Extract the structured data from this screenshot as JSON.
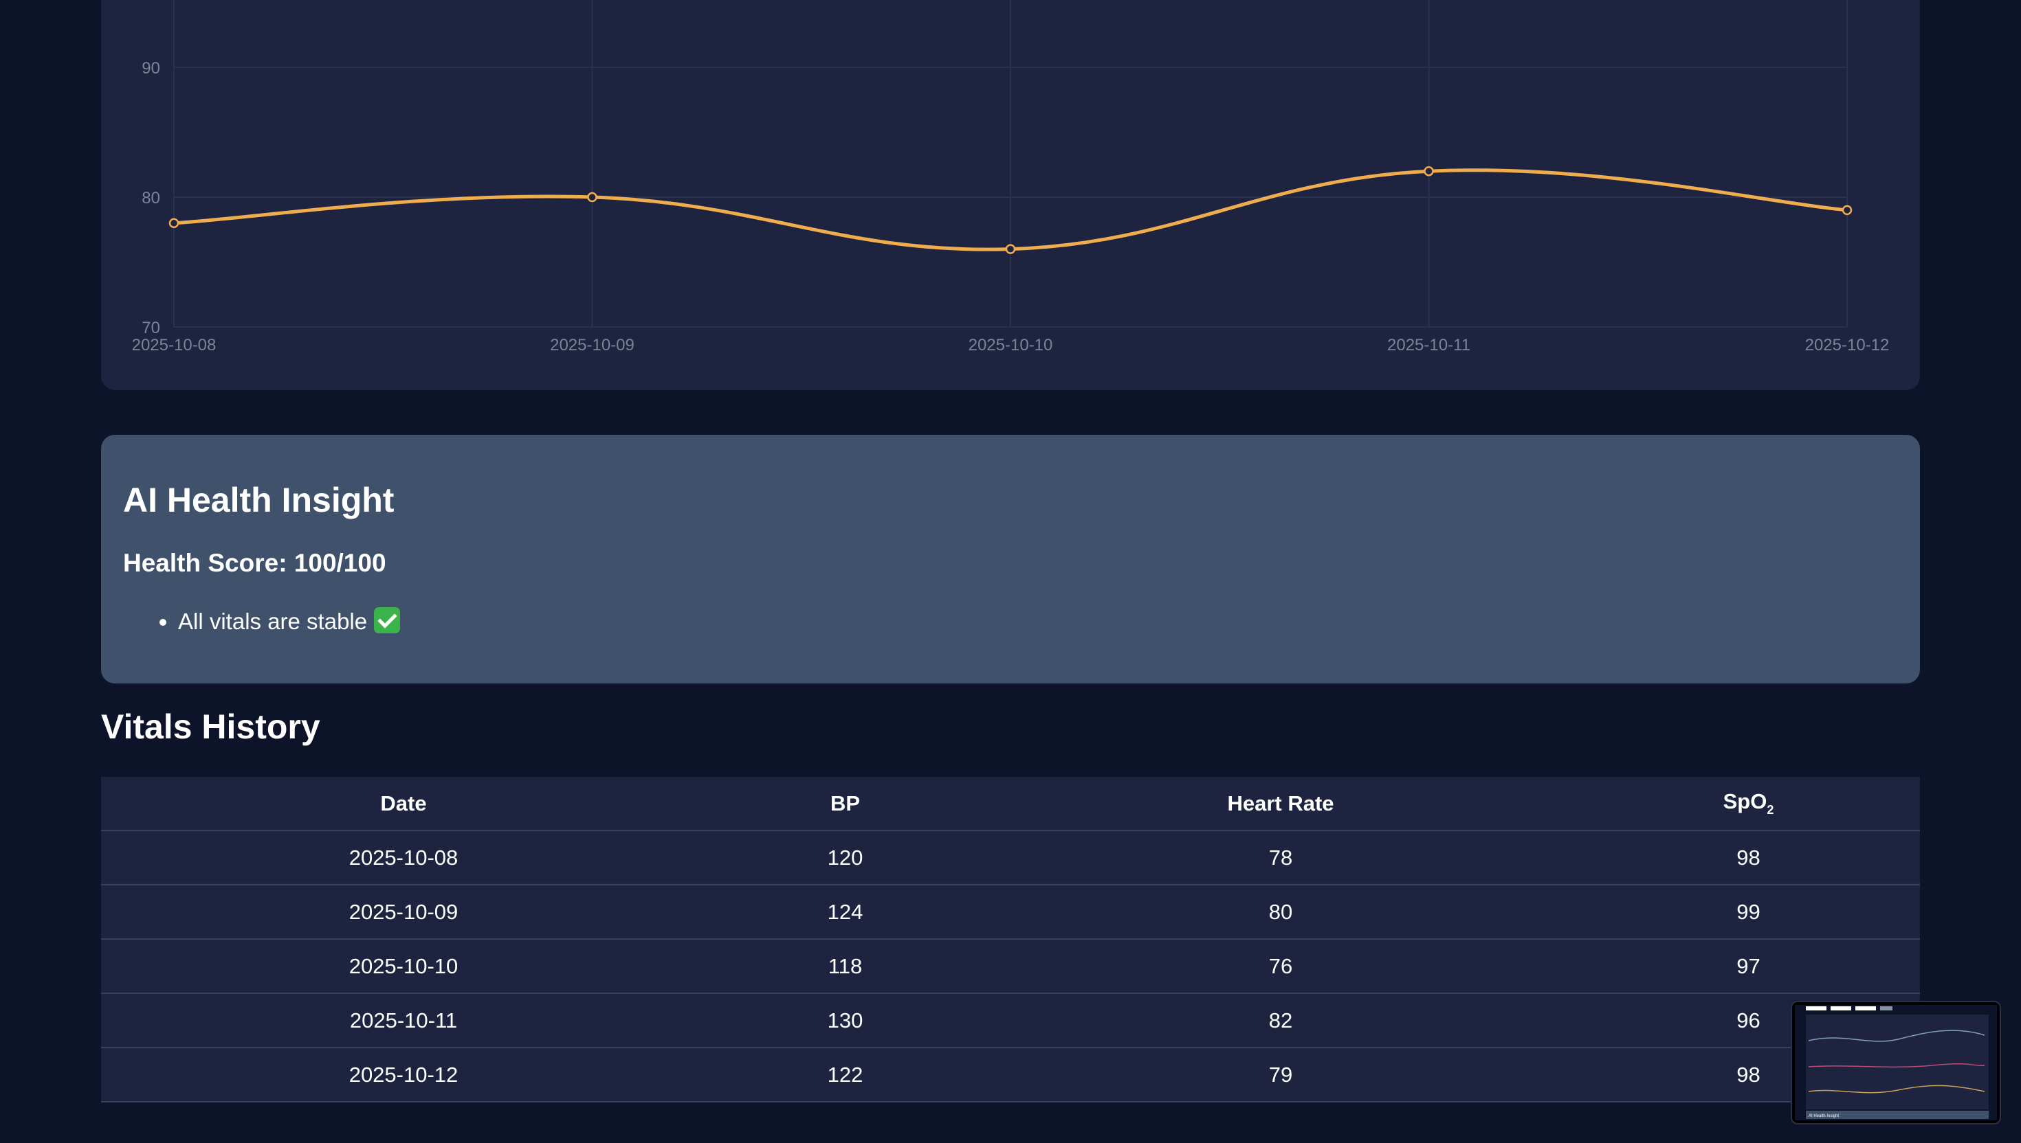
{
  "chart_data": {
    "type": "line",
    "x": [
      "2025-10-08",
      "2025-10-09",
      "2025-10-10",
      "2025-10-11",
      "2025-10-12"
    ],
    "series": [
      {
        "values": [
          78,
          80,
          76,
          82,
          79
        ],
        "color": "#f0ad4e"
      }
    ],
    "yticks": [
      70,
      80,
      90
    ],
    "ylim": [
      70,
      90
    ],
    "grid": true
  },
  "insight": {
    "title": "AI Health Insight",
    "score": "Health Score: 100/100",
    "items": [
      "All vitals are stable"
    ],
    "item_icon": "check-mark-icon"
  },
  "history": {
    "title": "Vitals History",
    "headers": {
      "date": "Date",
      "bp": "BP",
      "heart_rate": "Heart Rate",
      "spo2": "SpO",
      "spo2_sub": "2"
    },
    "rows": [
      {
        "date": "2025-10-08",
        "bp": "120",
        "heart_rate": "78",
        "spo2": "98"
      },
      {
        "date": "2025-10-09",
        "bp": "124",
        "heart_rate": "80",
        "spo2": "99"
      },
      {
        "date": "2025-10-10",
        "bp": "118",
        "heart_rate": "76",
        "spo2": "97"
      },
      {
        "date": "2025-10-11",
        "bp": "130",
        "heart_rate": "82",
        "spo2": "96"
      },
      {
        "date": "2025-10-12",
        "bp": "122",
        "heart_rate": "79",
        "spo2": "98"
      }
    ]
  },
  "thumbnail": {
    "title": "AI Health Insight"
  }
}
